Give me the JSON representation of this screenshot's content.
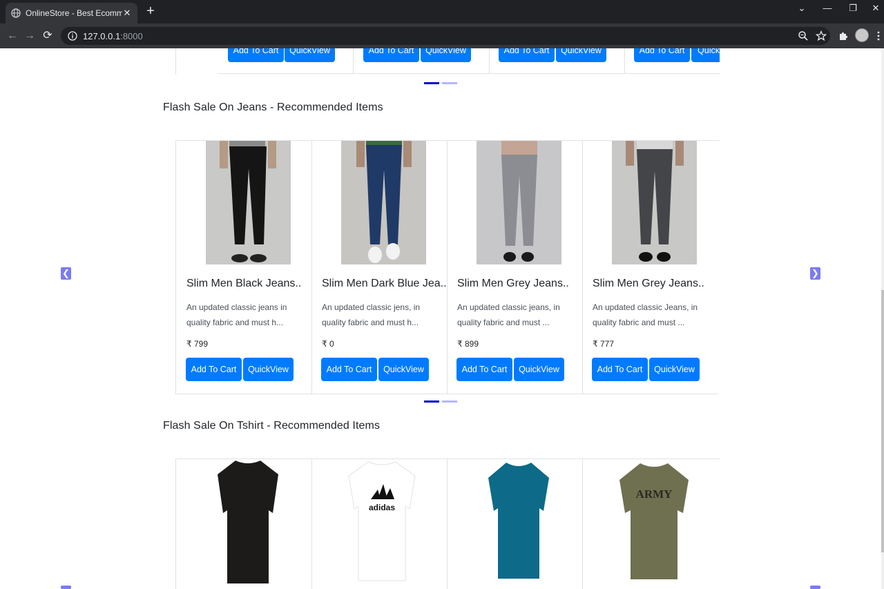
{
  "browser": {
    "tab_title": "OnlineStore - Best Ecommerce W",
    "close_glyph": "✕",
    "new_tab_glyph": "+",
    "url_host": "127.0.0.1",
    "url_port": ":8000",
    "back_glyph": "←",
    "forward_glyph": "→",
    "reload_glyph": "⟳",
    "window_controls": {
      "menu": "⌄",
      "minimize": "—",
      "restore": "❐",
      "close": "✕"
    }
  },
  "top_section": {
    "buttons": [
      {
        "cart": "Add To Cart",
        "quickview": "QuickView"
      },
      {
        "cart": "Add To Cart",
        "quickview": "QuickView"
      },
      {
        "cart": "Add To Cart",
        "quickview": "QuickView"
      },
      {
        "cart": "Add To Cart",
        "quickview": "Quick"
      }
    ]
  },
  "jeans_section": {
    "title": "Flash Sale On Jeans - Recommended Items",
    "products": [
      {
        "name": "Slim Men Black Jeans..",
        "desc": "An updated classic jeans in quality fabric and must h...",
        "price": "₹ 799",
        "cart_label": "Add To Cart",
        "quickview_label": "QuickView",
        "image": "black-jeans-image"
      },
      {
        "name": "Slim Men Dark Blue Jea..",
        "desc": "An updated classic jens, in quality fabric and must h...",
        "price": "₹ 0",
        "cart_label": "Add To Cart",
        "quickview_label": "QuickView",
        "image": "dark-blue-jeans-image"
      },
      {
        "name": "Slim Men Grey Jeans..",
        "desc": "An updated classic jeans, in quality fabric and must ...",
        "price": "₹ 899",
        "cart_label": "Add To Cart",
        "quickview_label": "QuickView",
        "image": "grey-jeans-image"
      },
      {
        "name": "Slim Men Grey Jeans..",
        "desc": "An updated classic Jeans, in quality fabric and must ...",
        "price": "₹ 777",
        "cart_label": "Add To Cart",
        "quickview_label": "QuickView",
        "image": "dark-grey-jeans-image"
      }
    ]
  },
  "tshirt_section": {
    "title": "Flash Sale On Tshirt - Recommended Items",
    "products": [
      {
        "image": "black-tshirt-image"
      },
      {
        "image": "white-adidas-tshirt-image",
        "print_text": "adidas"
      },
      {
        "image": "teal-tshirt-image"
      },
      {
        "image": "olive-army-tshirt-image",
        "print_text": "ARMY"
      }
    ]
  },
  "carousel": {
    "prev_glyph": "❮",
    "next_glyph": "❯",
    "slide_count": 2,
    "active_slide": 1
  },
  "colors": {
    "primary": "#007bff",
    "control": "#7b7bf0",
    "indicator_active": "#0000c8",
    "indicator_inactive": "#b5b5ff"
  }
}
